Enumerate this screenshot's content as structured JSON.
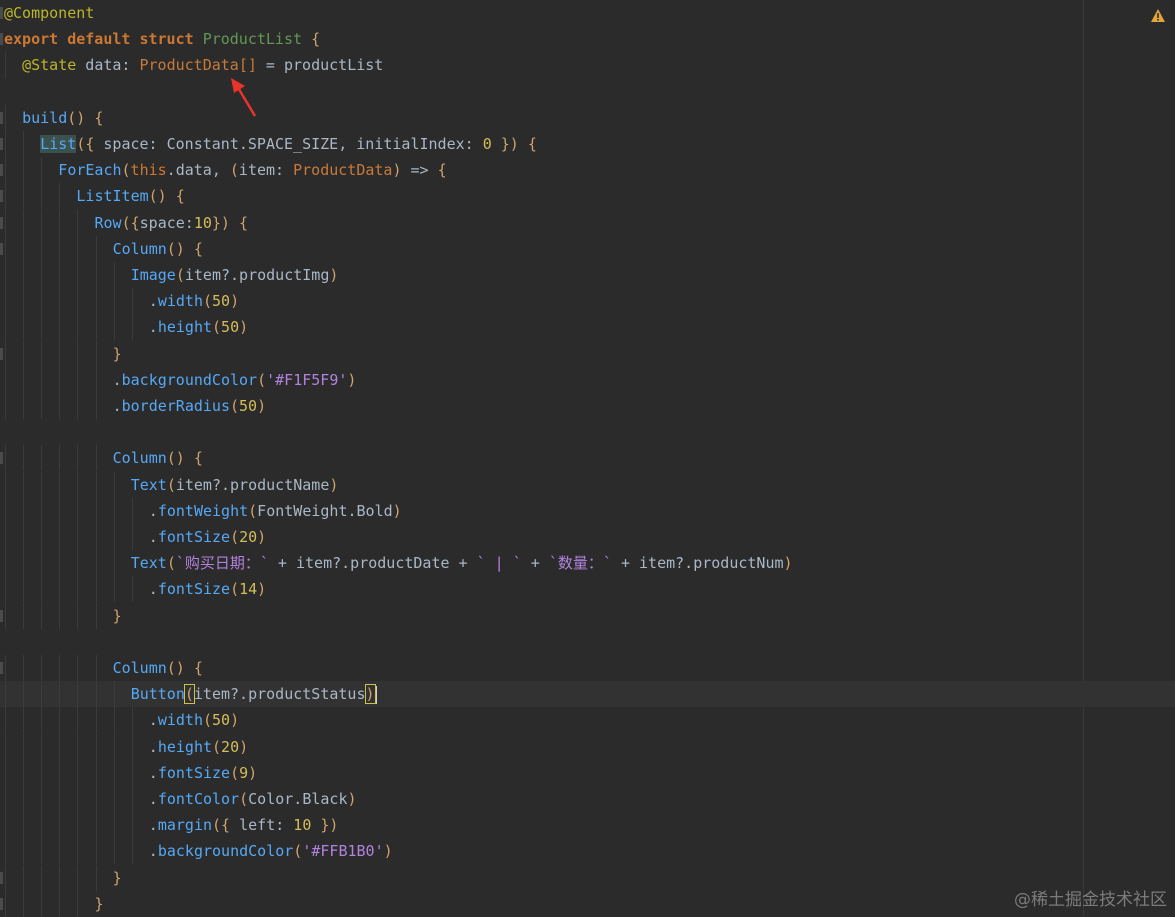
{
  "code_lines": [
    {
      "indent": 0,
      "tokens": [
        {
          "t": "@Component",
          "c": "anno"
        }
      ]
    },
    {
      "indent": 0,
      "tokens": [
        {
          "t": "export",
          "c": "kwb"
        },
        {
          "t": " "
        },
        {
          "t": "default",
          "c": "kwb"
        },
        {
          "t": " "
        },
        {
          "t": "struct",
          "c": "kwb"
        },
        {
          "t": " "
        },
        {
          "t": "ProductList",
          "c": "type"
        },
        {
          "t": " "
        },
        {
          "t": "{",
          "c": "punc"
        }
      ]
    },
    {
      "indent": 1,
      "tokens": [
        {
          "t": "@State",
          "c": "anno"
        },
        {
          "t": " data: "
        },
        {
          "t": "ProductData",
          "c": "typeref"
        },
        {
          "t": "[]",
          "c": "typeref"
        },
        {
          "t": " = productList"
        }
      ]
    },
    {
      "indent": 0,
      "tokens": []
    },
    {
      "indent": 1,
      "tokens": [
        {
          "t": "build",
          "c": "call"
        },
        {
          "t": "()",
          "c": "punc"
        },
        {
          "t": " "
        },
        {
          "t": "{",
          "c": "punc"
        }
      ]
    },
    {
      "indent": 2,
      "tokens": [
        {
          "t": "List",
          "c": "call",
          "hl": true
        },
        {
          "t": "({",
          "c": "punc"
        },
        {
          "t": " space: Constant.SPACE_SIZE, initialIndex: "
        },
        {
          "t": "0",
          "c": "num"
        },
        {
          "t": " "
        },
        {
          "t": "})",
          "c": "punc"
        },
        {
          "t": " "
        },
        {
          "t": "{",
          "c": "punc"
        }
      ]
    },
    {
      "indent": 3,
      "tokens": [
        {
          "t": "ForEach",
          "c": "call"
        },
        {
          "t": "(",
          "c": "punc"
        },
        {
          "t": "this",
          "c": "this"
        },
        {
          "t": ".data, "
        },
        {
          "t": "(",
          "c": "punc"
        },
        {
          "t": "item: "
        },
        {
          "t": "ProductData",
          "c": "typeref"
        },
        {
          "t": ")",
          "c": "punc"
        },
        {
          "t": " => "
        },
        {
          "t": "{",
          "c": "punc"
        }
      ]
    },
    {
      "indent": 4,
      "tokens": [
        {
          "t": "ListItem",
          "c": "call"
        },
        {
          "t": "()",
          "c": "punc"
        },
        {
          "t": " "
        },
        {
          "t": "{",
          "c": "punc"
        }
      ]
    },
    {
      "indent": 5,
      "tokens": [
        {
          "t": "Row",
          "c": "call"
        },
        {
          "t": "({",
          "c": "punc"
        },
        {
          "t": "space:"
        },
        {
          "t": "10",
          "c": "num"
        },
        {
          "t": "})",
          "c": "punc"
        },
        {
          "t": " "
        },
        {
          "t": "{",
          "c": "punc"
        }
      ]
    },
    {
      "indent": 6,
      "tokens": [
        {
          "t": "Column",
          "c": "call"
        },
        {
          "t": "()",
          "c": "punc"
        },
        {
          "t": " "
        },
        {
          "t": "{",
          "c": "punc"
        }
      ]
    },
    {
      "indent": 7,
      "tokens": [
        {
          "t": "Image",
          "c": "call"
        },
        {
          "t": "(",
          "c": "punc"
        },
        {
          "t": "item?.productImg"
        },
        {
          "t": ")",
          "c": "punc"
        }
      ]
    },
    {
      "indent": 8,
      "tokens": [
        {
          "t": "."
        },
        {
          "t": "width",
          "c": "call"
        },
        {
          "t": "(",
          "c": "punc"
        },
        {
          "t": "50",
          "c": "num"
        },
        {
          "t": ")",
          "c": "punc"
        }
      ]
    },
    {
      "indent": 8,
      "tokens": [
        {
          "t": "."
        },
        {
          "t": "height",
          "c": "call"
        },
        {
          "t": "(",
          "c": "punc"
        },
        {
          "t": "50",
          "c": "num"
        },
        {
          "t": ")",
          "c": "punc"
        }
      ]
    },
    {
      "indent": 6,
      "tokens": [
        {
          "t": "}",
          "c": "punc"
        }
      ]
    },
    {
      "indent": 6,
      "tokens": [
        {
          "t": "."
        },
        {
          "t": "backgroundColor",
          "c": "call"
        },
        {
          "t": "(",
          "c": "punc"
        },
        {
          "t": "'#F1F5F9'",
          "c": "strhash"
        },
        {
          "t": ")",
          "c": "punc"
        }
      ]
    },
    {
      "indent": 6,
      "tokens": [
        {
          "t": "."
        },
        {
          "t": "borderRadius",
          "c": "call"
        },
        {
          "t": "(",
          "c": "punc"
        },
        {
          "t": "50",
          "c": "num"
        },
        {
          "t": ")",
          "c": "punc"
        }
      ]
    },
    {
      "indent": 0,
      "tokens": []
    },
    {
      "indent": 6,
      "tokens": [
        {
          "t": "Column",
          "c": "call"
        },
        {
          "t": "()",
          "c": "punc"
        },
        {
          "t": " "
        },
        {
          "t": "{",
          "c": "punc"
        }
      ]
    },
    {
      "indent": 7,
      "tokens": [
        {
          "t": "Text",
          "c": "call"
        },
        {
          "t": "(",
          "c": "punc"
        },
        {
          "t": "item?.productName"
        },
        {
          "t": ")",
          "c": "punc"
        }
      ]
    },
    {
      "indent": 8,
      "tokens": [
        {
          "t": "."
        },
        {
          "t": "fontWeight",
          "c": "call"
        },
        {
          "t": "(",
          "c": "punc"
        },
        {
          "t": "FontWeight.Bold"
        },
        {
          "t": ")",
          "c": "punc"
        }
      ]
    },
    {
      "indent": 8,
      "tokens": [
        {
          "t": "."
        },
        {
          "t": "fontSize",
          "c": "call"
        },
        {
          "t": "(",
          "c": "punc"
        },
        {
          "t": "20",
          "c": "num"
        },
        {
          "t": ")",
          "c": "punc"
        }
      ]
    },
    {
      "indent": 7,
      "tokens": [
        {
          "t": "Text",
          "c": "call"
        },
        {
          "t": "(",
          "c": "punc"
        },
        {
          "t": "`购买日期：`",
          "c": "strhash"
        },
        {
          "t": " + item?.productDate + "
        },
        {
          "t": "` | `",
          "c": "strhash"
        },
        {
          "t": " + "
        },
        {
          "t": "`数量：`",
          "c": "strhash"
        },
        {
          "t": " + item?.productNum"
        },
        {
          "t": ")",
          "c": "punc"
        }
      ]
    },
    {
      "indent": 8,
      "tokens": [
        {
          "t": "."
        },
        {
          "t": "fontSize",
          "c": "call"
        },
        {
          "t": "(",
          "c": "punc"
        },
        {
          "t": "14",
          "c": "num"
        },
        {
          "t": ")",
          "c": "punc"
        }
      ]
    },
    {
      "indent": 6,
      "tokens": [
        {
          "t": "}",
          "c": "punc"
        }
      ]
    },
    {
      "indent": 0,
      "tokens": []
    },
    {
      "indent": 6,
      "tokens": [
        {
          "t": "Column",
          "c": "call"
        },
        {
          "t": "()",
          "c": "punc"
        },
        {
          "t": " "
        },
        {
          "t": "{",
          "c": "punc"
        }
      ]
    },
    {
      "indent": 7,
      "current": true,
      "tokens": [
        {
          "t": "Button",
          "c": "call"
        },
        {
          "t": "(",
          "c": "punc",
          "box": true
        },
        {
          "t": "item?.productStatus"
        },
        {
          "t": ")",
          "c": "punc",
          "box": true,
          "caret": true
        }
      ]
    },
    {
      "indent": 8,
      "tokens": [
        {
          "t": "."
        },
        {
          "t": "width",
          "c": "call"
        },
        {
          "t": "(",
          "c": "punc"
        },
        {
          "t": "50",
          "c": "num"
        },
        {
          "t": ")",
          "c": "punc"
        }
      ]
    },
    {
      "indent": 8,
      "tokens": [
        {
          "t": "."
        },
        {
          "t": "height",
          "c": "call"
        },
        {
          "t": "(",
          "c": "punc"
        },
        {
          "t": "20",
          "c": "num"
        },
        {
          "t": ")",
          "c": "punc"
        }
      ]
    },
    {
      "indent": 8,
      "tokens": [
        {
          "t": "."
        },
        {
          "t": "fontSize",
          "c": "call"
        },
        {
          "t": "(",
          "c": "punc"
        },
        {
          "t": "9",
          "c": "num"
        },
        {
          "t": ")",
          "c": "punc"
        }
      ]
    },
    {
      "indent": 8,
      "tokens": [
        {
          "t": "."
        },
        {
          "t": "fontColor",
          "c": "call"
        },
        {
          "t": "(",
          "c": "punc"
        },
        {
          "t": "Color.Black"
        },
        {
          "t": ")",
          "c": "punc"
        }
      ]
    },
    {
      "indent": 8,
      "tokens": [
        {
          "t": "."
        },
        {
          "t": "margin",
          "c": "call"
        },
        {
          "t": "({",
          "c": "punc"
        },
        {
          "t": " left: "
        },
        {
          "t": "10",
          "c": "num"
        },
        {
          "t": " "
        },
        {
          "t": "})",
          "c": "punc"
        }
      ]
    },
    {
      "indent": 8,
      "tokens": [
        {
          "t": "."
        },
        {
          "t": "backgroundColor",
          "c": "call"
        },
        {
          "t": "(",
          "c": "punc"
        },
        {
          "t": "'#FFB1B0'",
          "c": "strhash"
        },
        {
          "t": ")",
          "c": "punc"
        }
      ]
    },
    {
      "indent": 6,
      "tokens": [
        {
          "t": "}",
          "c": "punc"
        }
      ]
    },
    {
      "indent": 5,
      "tokens": [
        {
          "t": "}",
          "c": "punc"
        }
      ]
    }
  ],
  "watermark": "@稀土掘金技术社区",
  "warning_icon": "warning-icon",
  "arrow_color": "#e8342b"
}
